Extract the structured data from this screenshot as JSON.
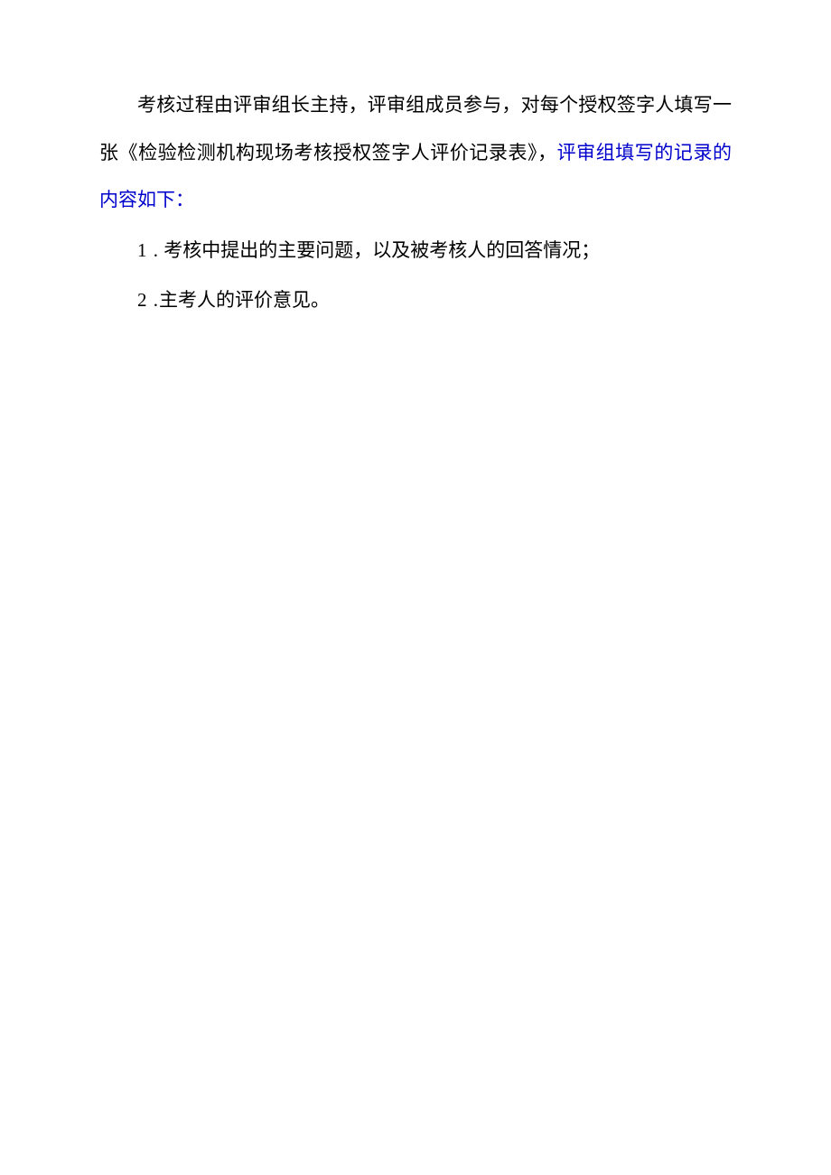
{
  "intro": {
    "part1": "考核过程由评审组长主持，评审组成员参与，对每个授权签字人填写一张《检验检测机构现场考核授权签字人评价记录表》，",
    "highlight": "评审组填写的记录的内容如下：",
    "part2": ""
  },
  "items": [
    {
      "number": "1 .",
      "text": " 考核中提出的主要问题，以及被考核人的回答情况；"
    },
    {
      "number": "2 .",
      "text": "主考人的评价意见。"
    }
  ]
}
